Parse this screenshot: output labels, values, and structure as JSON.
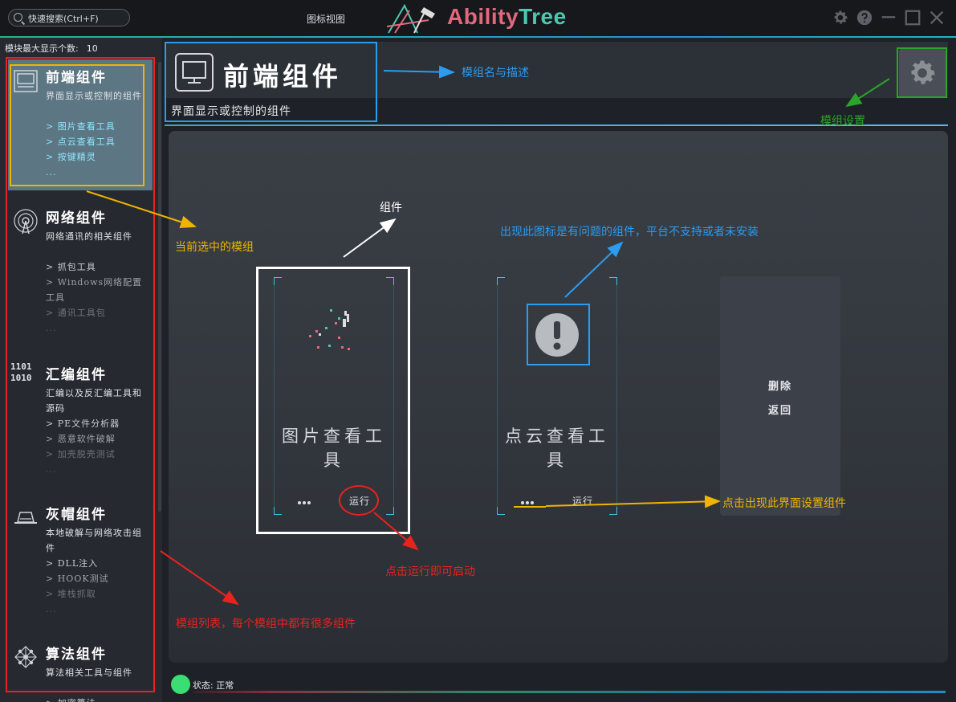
{
  "titlebar": {
    "search_placeholder": "快速搜索(Ctrl+F)",
    "view_label": "图标视图",
    "logo_part1": "Ability",
    "logo_part2": "Tree",
    "icons": [
      "gear-icon",
      "help-icon",
      "minimize-icon",
      "maximize-icon",
      "close-icon"
    ]
  },
  "sidebar": {
    "max_count_label": "模块最大显示个数:",
    "max_count_value": "10",
    "modules": [
      {
        "title": "前端组件",
        "desc": "界面显示或控制的组件",
        "items": [
          "> 图片查看工具",
          "> 点云查看工具",
          "> 按键精灵",
          "..."
        ],
        "icon": "monitor-icon",
        "selected": true
      },
      {
        "title": "网络组件",
        "desc": "网络通讯的相关组件",
        "items": [
          "> 抓包工具",
          "> Windows网络配置工具",
          "> 通讯工具包",
          "..."
        ],
        "icon": "antenna-icon"
      },
      {
        "title": "汇编组件",
        "desc": "汇编以及反汇编工具和源码",
        "items": [
          "> PE文件分析器",
          "> 恶意软件破解",
          "> 加壳脱壳测试",
          "..."
        ],
        "icon": "binary-icon",
        "icon_text_1": "1101",
        "icon_text_2": "1010"
      },
      {
        "title": "灰帽组件",
        "desc": "本地破解与网络攻击组件",
        "items": [
          "> DLL注入",
          "> HOOK测试",
          "> 堆栈抓取",
          "..."
        ],
        "icon": "hat-icon"
      },
      {
        "title": "算法组件",
        "desc": "算法相关工具与组件",
        "items": [
          "> 加密算法"
        ],
        "icon": "network-graph-icon"
      }
    ]
  },
  "header": {
    "title": "前端组件",
    "desc": "界面显示或控制的组件",
    "icon": "monitor-icon",
    "settings_icon": "gear-icon"
  },
  "cards": [
    {
      "name": "图片查看工具",
      "more": "...",
      "run": "运行",
      "icon": "pixel-art-icon"
    },
    {
      "name": "点云查看工具",
      "more": "...",
      "run": "运行",
      "icon": "warning-icon"
    }
  ],
  "menu": {
    "delete": "删除",
    "back": "返回"
  },
  "status": {
    "text": "状态: 正常",
    "color": "#3bde73"
  },
  "annotations": {
    "module_name_desc": "模组名与描述",
    "module_settings": "模组设置",
    "component": "组件",
    "current_selected": "当前选中的模组",
    "problem_icon": "出现此图标是有问题的组件，平台不支持或者未安装",
    "click_settings": "点击出现此界面设置组件",
    "click_run": "点击运行即可启动",
    "module_list": "模组列表，每个模组中都有很多组件"
  },
  "colors": {
    "accent_cyan": "#39c5e8",
    "annot_blue": "#2b9cf0",
    "annot_green": "#2aa52a",
    "annot_yellow": "#f0b400",
    "annot_red": "#e8231e",
    "annot_white": "#ffffff"
  }
}
